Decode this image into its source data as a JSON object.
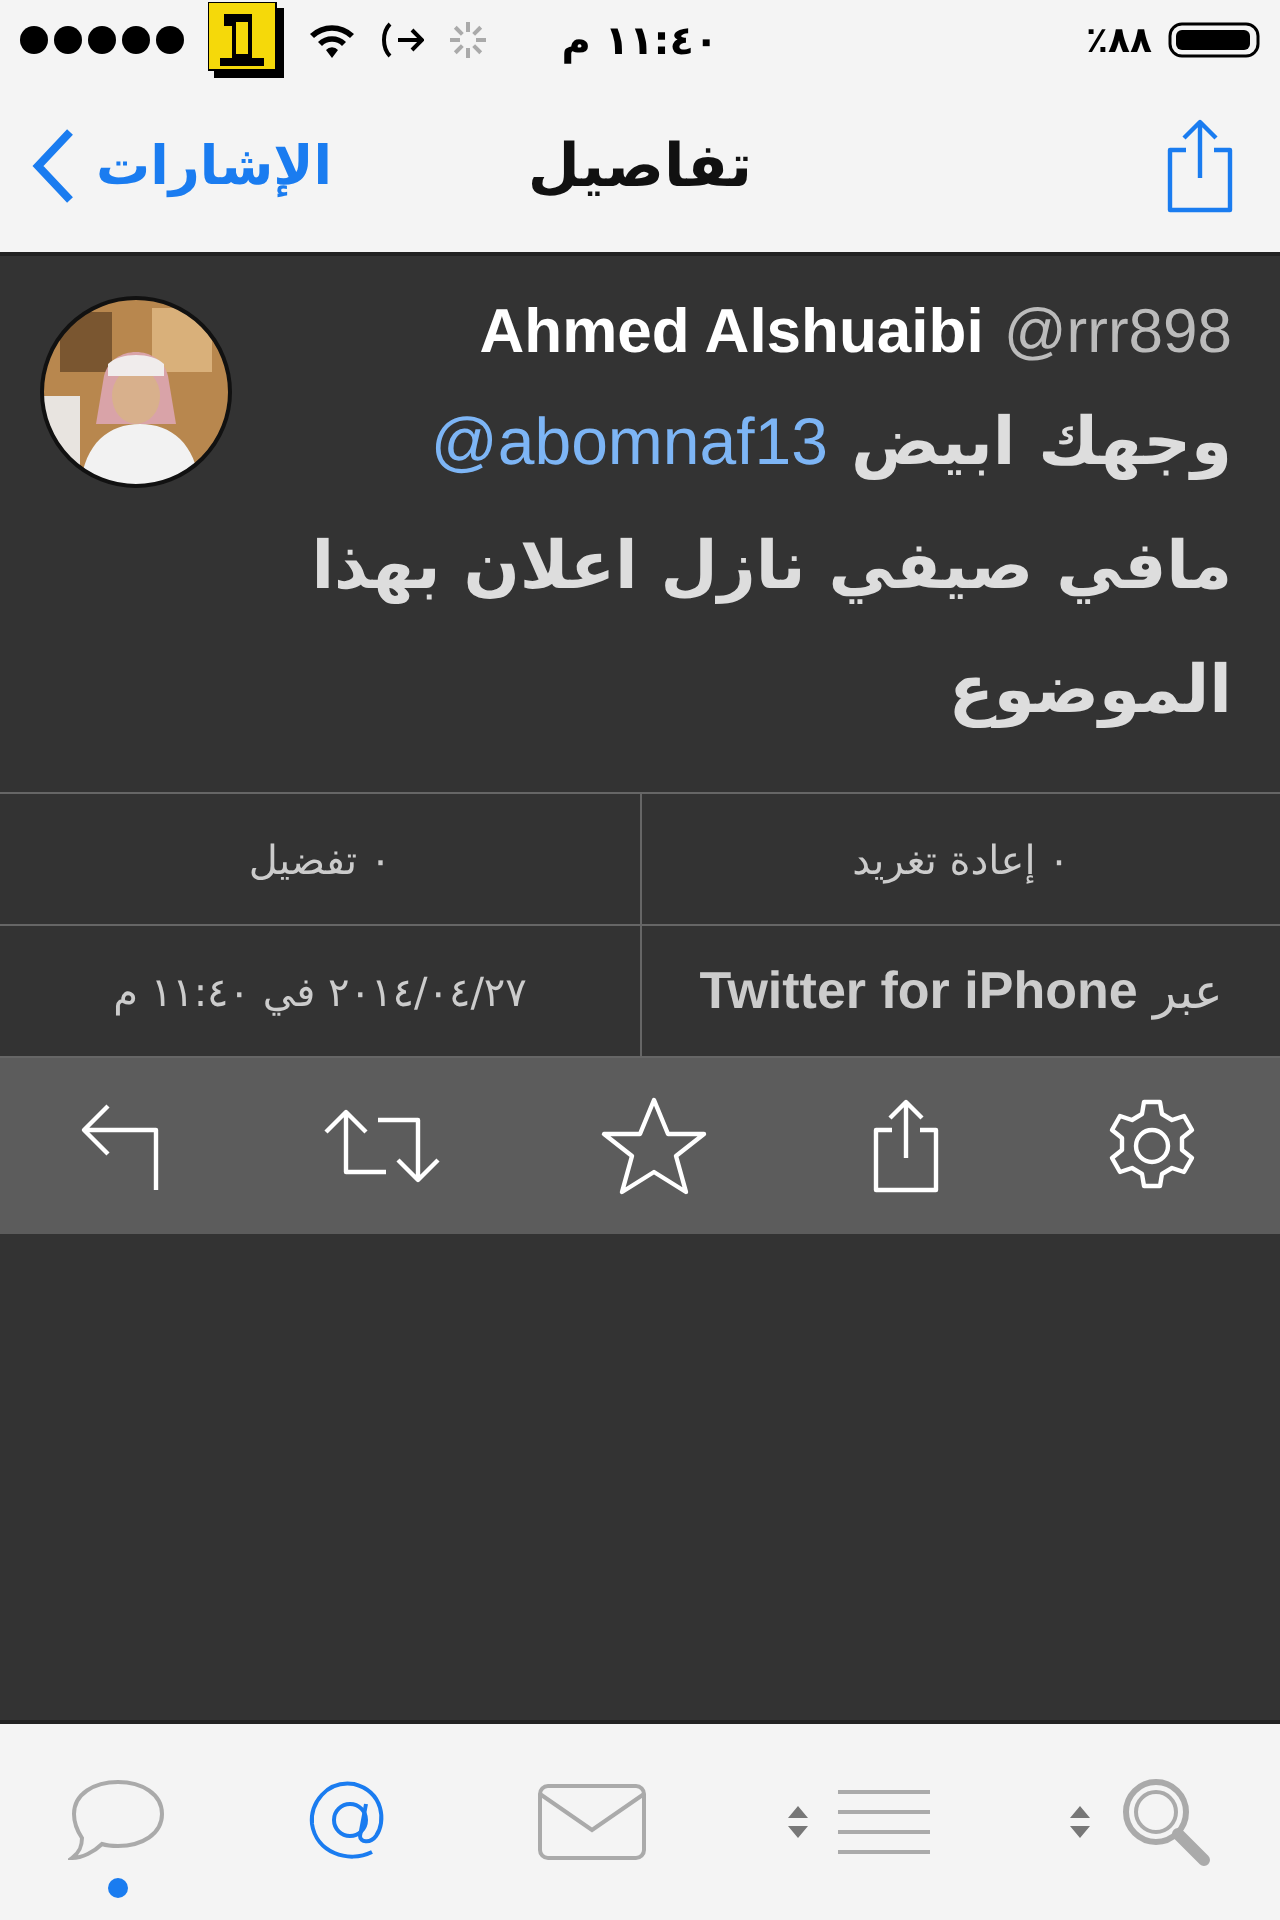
{
  "status_bar": {
    "time": "١١:٤٠ م",
    "battery": "٪٨٨"
  },
  "nav": {
    "back": "الإشارات",
    "title": "تفاصيل"
  },
  "tweet": {
    "name": "Ahmed Alshuaibi",
    "handle": "@rrr898",
    "segments": [
      {
        "kind": "text",
        "text": "وجهك ابيض"
      },
      {
        "kind": "mention",
        "text": "@abomnaf13"
      },
      {
        "kind": "text",
        "text": "مافي صيفي نازل اعلان بهذا الموضوع"
      }
    ]
  },
  "stats": [
    {
      "kind": "count",
      "text": "٠ إعادة تغريد"
    },
    {
      "kind": "count",
      "text": "٠ تفضيل"
    },
    {
      "kind": "source",
      "text": "عبر **Twitter for iPhone**"
    },
    {
      "kind": "date",
      "text": "٢٠١٤/٠٤/٢٧ في ١١:٤٠ م"
    }
  ],
  "actions": [
    {
      "kind": "reply"
    },
    {
      "kind": "retweet"
    },
    {
      "kind": "favorite"
    },
    {
      "kind": "share"
    },
    {
      "kind": "settings"
    }
  ],
  "tabs": [
    {
      "kind": "timeline",
      "selected": false,
      "unread": true
    },
    {
      "kind": "mentions",
      "selected": true,
      "unread": false
    },
    {
      "kind": "messages",
      "selected": false,
      "unread": false
    },
    {
      "kind": "lists",
      "selected": false,
      "unread": false
    },
    {
      "kind": "search",
      "selected": false,
      "unread": false
    }
  ]
}
